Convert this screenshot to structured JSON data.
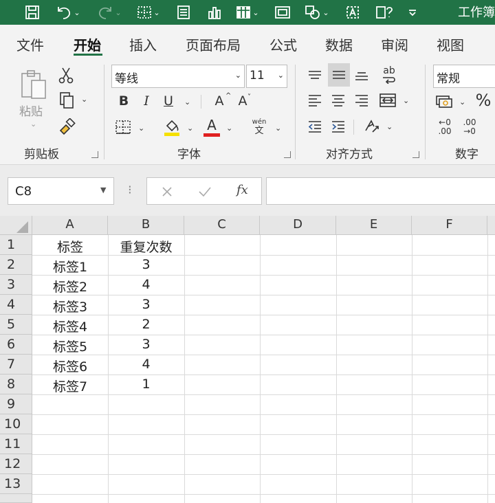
{
  "title_bar": {
    "document_title": "工作簿",
    "quick_access_icons": [
      "save-icon",
      "undo-icon",
      "redo-icon",
      "borders-icon",
      "form-icon",
      "chart-icon",
      "table-icon",
      "screenshot-icon",
      "shapes-icon",
      "textbox-icon",
      "help-icon",
      "customize-icon"
    ]
  },
  "ribbon_tabs": [
    "文件",
    "开始",
    "插入",
    "页面布局",
    "公式",
    "数据",
    "审阅",
    "视图"
  ],
  "active_tab": "开始",
  "clipboard": {
    "paste_label": "粘贴",
    "group_label": "剪贴板"
  },
  "font": {
    "font_name": "等线",
    "font_size": "11",
    "bold": "B",
    "italic": "I",
    "underline": "U",
    "grow": "A",
    "shrink": "A",
    "phonetic_top": "wén",
    "phonetic_bottom": "文",
    "font_color_label": "A",
    "group_label": "字体"
  },
  "alignment": {
    "wrap_label": "ab",
    "group_label": "对齐方式"
  },
  "number": {
    "format": "常规",
    "percent": "%",
    "increase_decimal_top": "←0",
    "increase_decimal_bottom": ".00",
    "decrease_decimal_top": ".00",
    "decrease_decimal_bottom": "→0",
    "group_label": "数字"
  },
  "formula_bar": {
    "name_box": "C8",
    "fx_label": "fx",
    "formula": ""
  },
  "grid": {
    "columns": [
      "A",
      "B",
      "C",
      "D",
      "E",
      "F"
    ],
    "row_numbers": [
      "1",
      "2",
      "3",
      "4",
      "5",
      "6",
      "7",
      "8",
      "9",
      "10",
      "11",
      "12",
      "13"
    ],
    "rows": [
      [
        "标签",
        "重复次数"
      ],
      [
        "标签1",
        "3"
      ],
      [
        "标签2",
        "4"
      ],
      [
        "标签3",
        "3"
      ],
      [
        "标签4",
        "2"
      ],
      [
        "标签5",
        "3"
      ],
      [
        "标签6",
        "4"
      ],
      [
        "标签7",
        "1"
      ]
    ]
  },
  "colors": {
    "title_bar": "#217346",
    "ribbon": "#f3f3f3",
    "header": "#e6e6e6",
    "font_color_bar": "#e02020",
    "fill_color_bar": "#f5e000"
  }
}
